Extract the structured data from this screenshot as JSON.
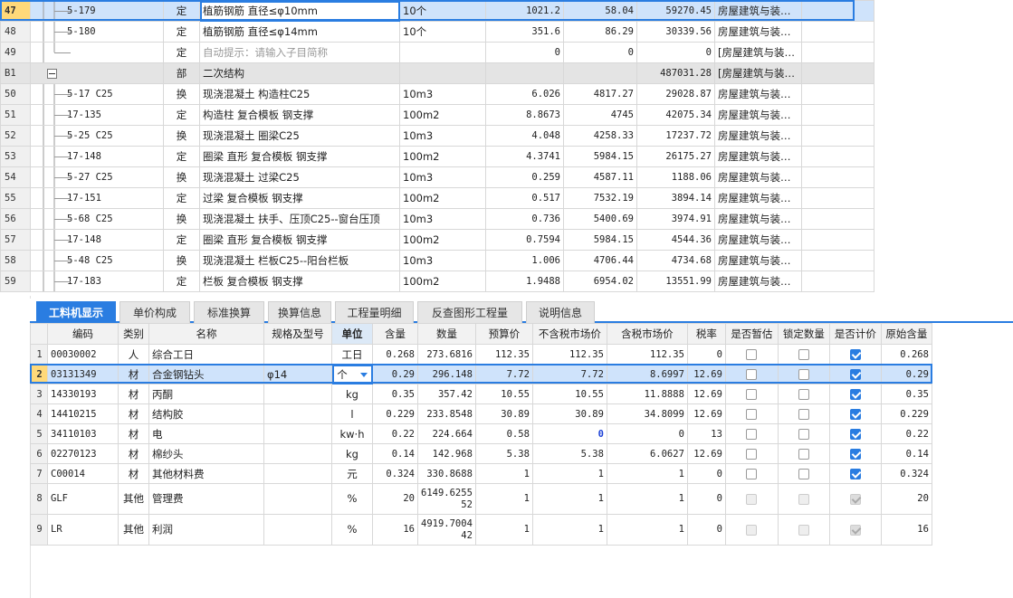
{
  "top_rows": [
    {
      "num": "47",
      "code": "5-179",
      "type": "定",
      "name": "植筋钢筋 直径≤φ10mm",
      "unit": "10个",
      "qty": "1021.2",
      "price": "58.04",
      "total": "59270.45",
      "spec": "房屋建筑与装…",
      "selected": true
    },
    {
      "num": "48",
      "code": "5-180",
      "type": "定",
      "name": "植筋钢筋 直径≤φ14mm",
      "unit": "10个",
      "qty": "351.6",
      "price": "86.29",
      "total": "30339.56",
      "spec": "房屋建筑与装…"
    },
    {
      "num": "49",
      "code": "",
      "type": "定",
      "name": "自动提示：请输入子目简称",
      "unit": "",
      "qty": "0",
      "price": "0",
      "total": "0",
      "spec": "[房屋建筑与装…",
      "hint": true
    },
    {
      "num": "B1",
      "code": "",
      "type": "部",
      "name": "二次结构",
      "unit": "",
      "qty": "",
      "price": "",
      "total": "487031.28",
      "spec": "[房屋建筑与装…",
      "group": true
    },
    {
      "num": "50",
      "code": "5-17 C25",
      "type": "换",
      "name": "现浇混凝土 构造柱C25",
      "unit": "10m3",
      "qty": "6.026",
      "price": "4817.27",
      "total": "29028.87",
      "spec": "房屋建筑与装…"
    },
    {
      "num": "51",
      "code": "17-135",
      "type": "定",
      "name": "构造柱 复合模板 钢支撑",
      "unit": "100m2",
      "qty": "8.8673",
      "price": "4745",
      "total": "42075.34",
      "spec": "房屋建筑与装…"
    },
    {
      "num": "52",
      "code": "5-25 C25",
      "type": "换",
      "name": "现浇混凝土 圈梁C25",
      "unit": "10m3",
      "qty": "4.048",
      "price": "4258.33",
      "total": "17237.72",
      "spec": "房屋建筑与装…"
    },
    {
      "num": "53",
      "code": "17-148",
      "type": "定",
      "name": "圈梁 直形 复合模板 钢支撑",
      "unit": "100m2",
      "qty": "4.3741",
      "price": "5984.15",
      "total": "26175.27",
      "spec": "房屋建筑与装…"
    },
    {
      "num": "54",
      "code": "5-27 C25",
      "type": "换",
      "name": "现浇混凝土 过梁C25",
      "unit": "10m3",
      "qty": "0.259",
      "price": "4587.11",
      "total": "1188.06",
      "spec": "房屋建筑与装…"
    },
    {
      "num": "55",
      "code": "17-151",
      "type": "定",
      "name": "过梁 复合模板 钢支撑",
      "unit": "100m2",
      "qty": "0.517",
      "price": "7532.19",
      "total": "3894.14",
      "spec": "房屋建筑与装…"
    },
    {
      "num": "56",
      "code": "5-68 C25",
      "type": "换",
      "name": "现浇混凝土 扶手、压顶C25--窗台压顶",
      "unit": "10m3",
      "qty": "0.736",
      "price": "5400.69",
      "total": "3974.91",
      "spec": "房屋建筑与装…"
    },
    {
      "num": "57",
      "code": "17-148",
      "type": "定",
      "name": "圈梁 直形 复合模板 钢支撑",
      "unit": "100m2",
      "qty": "0.7594",
      "price": "5984.15",
      "total": "4544.36",
      "spec": "房屋建筑与装…"
    },
    {
      "num": "58",
      "code": "5-48 C25",
      "type": "换",
      "name": "现浇混凝土 栏板C25--阳台栏板",
      "unit": "10m3",
      "qty": "1.006",
      "price": "4706.44",
      "total": "4734.68",
      "spec": "房屋建筑与装…"
    },
    {
      "num": "59",
      "code": "17-183",
      "type": "定",
      "name": "栏板 复合模板 钢支撑",
      "unit": "100m2",
      "qty": "1.9488",
      "price": "6954.02",
      "total": "13551.99",
      "spec": "房屋建筑与装…"
    }
  ],
  "tabs": [
    "工料机显示",
    "单价构成",
    "标准换算",
    "换算信息",
    "工程量明细",
    "反查图形工程量",
    "说明信息"
  ],
  "bottom_headers": [
    "编码",
    "类别",
    "名称",
    "规格及型号",
    "单位",
    "含量",
    "数量",
    "预算价",
    "不含税市场价",
    "含税市场价",
    "税率",
    "是否暂估",
    "锁定数量",
    "是否计价",
    "原始含量"
  ],
  "bottom_rows": [
    {
      "num": "1",
      "code": "00030002",
      "cat": "人",
      "name": "综合工日",
      "spec": "",
      "unit": "工日",
      "content": "0.268",
      "qty": "273.6816",
      "budget": "112.35",
      "mkt_notax": "112.35",
      "mkt_tax": "112.35",
      "tax": "0",
      "est": false,
      "lock": false,
      "calc": true,
      "orig": "0.268"
    },
    {
      "num": "2",
      "code": "03131349",
      "cat": "材",
      "name": "合金钢钻头",
      "spec": "φ14",
      "unit": "个",
      "content": "0.29",
      "qty": "296.148",
      "budget": "7.72",
      "mkt_notax": "7.72",
      "mkt_tax": "8.6997",
      "tax": "12.69",
      "est": false,
      "lock": false,
      "calc": true,
      "orig": "0.29",
      "selected": true
    },
    {
      "num": "3",
      "code": "14330193",
      "cat": "材",
      "name": "丙酮",
      "spec": "",
      "unit": "kg",
      "content": "0.35",
      "qty": "357.42",
      "budget": "10.55",
      "mkt_notax": "10.55",
      "mkt_tax": "11.8888",
      "tax": "12.69",
      "est": false,
      "lock": false,
      "calc": true,
      "orig": "0.35"
    },
    {
      "num": "4",
      "code": "14410215",
      "cat": "材",
      "name": "结构胶",
      "spec": "",
      "unit": "l",
      "content": "0.229",
      "qty": "233.8548",
      "budget": "30.89",
      "mkt_notax": "30.89",
      "mkt_tax": "34.8099",
      "tax": "12.69",
      "est": false,
      "lock": false,
      "calc": true,
      "orig": "0.229"
    },
    {
      "num": "5",
      "code": "34110103",
      "cat": "材",
      "name": "电",
      "spec": "",
      "unit": "kw·h",
      "content": "0.22",
      "qty": "224.664",
      "budget": "0.58",
      "mkt_notax": "0",
      "mkt_tax": "0",
      "tax": "13",
      "est": false,
      "lock": false,
      "calc": true,
      "orig": "0.22",
      "blue_notax": true
    },
    {
      "num": "6",
      "code": "02270123",
      "cat": "材",
      "name": "棉纱头",
      "spec": "",
      "unit": "kg",
      "content": "0.14",
      "qty": "142.968",
      "budget": "5.38",
      "mkt_notax": "5.38",
      "mkt_tax": "6.0627",
      "tax": "12.69",
      "est": false,
      "lock": false,
      "calc": true,
      "orig": "0.14"
    },
    {
      "num": "7",
      "code": "C00014",
      "cat": "材",
      "name": "其他材料费",
      "spec": "",
      "unit": "元",
      "content": "0.324",
      "qty": "330.8688",
      "budget": "1",
      "mkt_notax": "1",
      "mkt_tax": "1",
      "tax": "0",
      "est": false,
      "lock": false,
      "calc": true,
      "orig": "0.324"
    },
    {
      "num": "8",
      "code": "GLF",
      "cat": "其他",
      "name": "管理费",
      "spec": "",
      "unit": "%",
      "content": "20",
      "qty": "6149.6255 52",
      "budget": "1",
      "mkt_notax": "1",
      "mkt_tax": "1",
      "tax": "0",
      "est": false,
      "lock": false,
      "calc": true,
      "orig": "20",
      "two": true,
      "disabled": true
    },
    {
      "num": "9",
      "code": "LR",
      "cat": "其他",
      "name": "利润",
      "spec": "",
      "unit": "%",
      "content": "16",
      "qty": "4919.7004 42",
      "budget": "1",
      "mkt_notax": "1",
      "mkt_tax": "1",
      "tax": "0",
      "est": false,
      "lock": false,
      "calc": true,
      "orig": "16",
      "two": true,
      "disabled": true
    }
  ],
  "colors": {
    "accent": "#2a7de1",
    "group_bg": "#e4e4e4",
    "selected_bg": "#cfe3fb",
    "rownum_sel": "#ffd97a"
  }
}
